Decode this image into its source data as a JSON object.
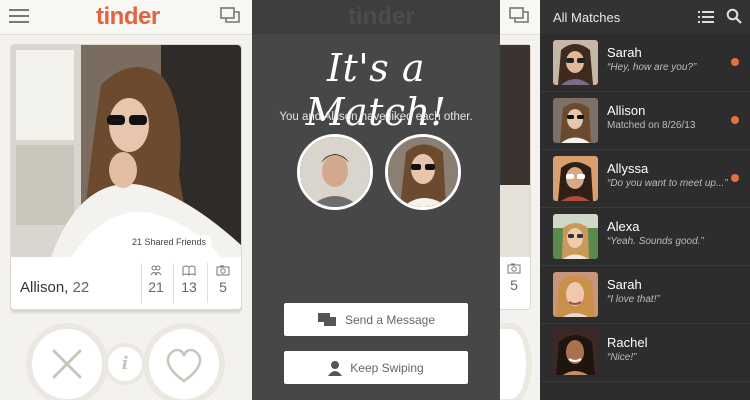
{
  "left": {
    "logo": "tinder",
    "card": {
      "name": "Allison,",
      "age": "22",
      "shared_friends": "21 Shared Friends",
      "stats": [
        {
          "icon": "friends-icon",
          "value": "21"
        },
        {
          "icon": "book-icon",
          "value": "13"
        },
        {
          "icon": "camera-icon",
          "value": "5"
        }
      ]
    },
    "info_label": "i"
  },
  "middle": {
    "title": "It's a Match!",
    "subtitle": "You and Allison have liked each other.",
    "send_label": "Send a Message",
    "keep_label": "Keep Swiping"
  },
  "strip": {
    "stat_value": "5"
  },
  "matches": {
    "title": "All Matches",
    "items": [
      {
        "name": "Sarah",
        "message": "“Hey, how are you?”",
        "unread": true
      },
      {
        "name": "Allison",
        "message": "Matched on 8/26/13",
        "unread": true
      },
      {
        "name": "Allyssa",
        "message": "“Do you want to meet up...”",
        "unread": true
      },
      {
        "name": "Alexa",
        "message": "“Yeah. Sounds good.”",
        "unread": false
      },
      {
        "name": "Sarah",
        "message": "“I love that!”",
        "unread": false
      },
      {
        "name": "Rachel",
        "message": "“Nice!”",
        "unread": false
      }
    ]
  },
  "colors": {
    "brand": "#e6613e",
    "unread": "#e8703e",
    "dark_bg": "#474747",
    "list_bg": "#2d2d2d"
  }
}
